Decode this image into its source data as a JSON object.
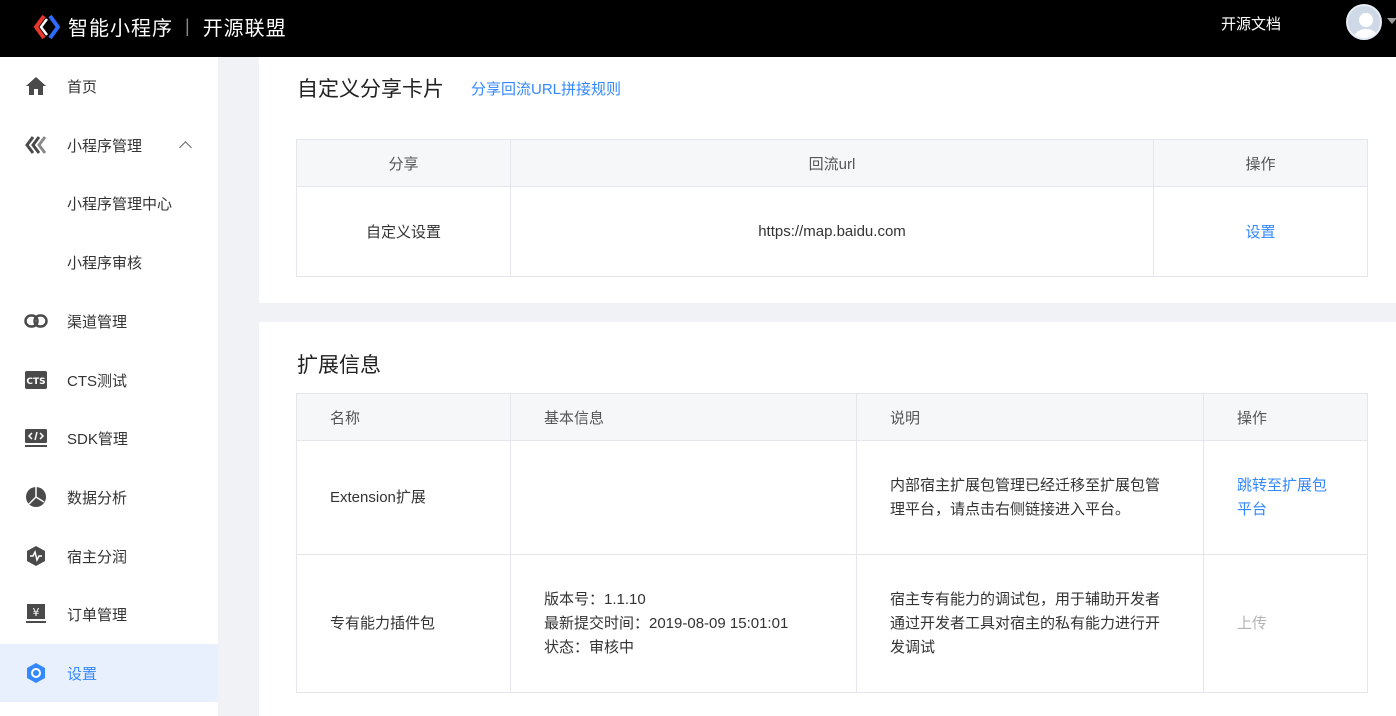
{
  "header": {
    "brand_main": "智能小程序",
    "brand_sub": "开源联盟",
    "doc_link": "开源文档"
  },
  "sidebar": {
    "items": [
      {
        "label": "首页",
        "icon": "home-icon"
      },
      {
        "label": "小程序管理",
        "icon": "miniprogram-icon"
      },
      {
        "label": "小程序管理中心"
      },
      {
        "label": "小程序审核"
      },
      {
        "label": "渠道管理",
        "icon": "link-icon"
      },
      {
        "label": "CTS测试",
        "icon": "cts-icon"
      },
      {
        "label": "SDK管理",
        "icon": "sdk-code-icon"
      },
      {
        "label": "数据分析",
        "icon": "pie-chart-icon"
      },
      {
        "label": "宿主分润",
        "icon": "pulse-icon"
      },
      {
        "label": "订单管理",
        "icon": "yen-monitor-icon"
      },
      {
        "label": "设置",
        "icon": "settings-icon"
      }
    ]
  },
  "share_card": {
    "title": "自定义分享卡片",
    "rule_link": "分享回流URL拼接规则",
    "columns": [
      "分享",
      "回流url",
      "操作"
    ],
    "rows": [
      {
        "share": "自定义设置",
        "url": "https://map.baidu.com",
        "action": "设置"
      }
    ]
  },
  "extension_card": {
    "title": "扩展信息",
    "columns": [
      "名称",
      "基本信息",
      "说明",
      "操作"
    ],
    "rows": [
      {
        "name": "Extension扩展",
        "info_lines": [
          "",
          "",
          ""
        ],
        "desc": "内部宿主扩展包管理已经迁移至扩展包管理平台，请点击右侧链接进入平台。",
        "action": "跳转至扩展包平台"
      },
      {
        "name": "专有能力插件包",
        "info_lines": [
          "版本号：1.1.10",
          "最新提交时间：2019-08-09 15:01:01",
          "状态：审核中"
        ],
        "desc": "宿主专有能力的调试包，用于辅助开发者通过开发者工具对宿主的私有能力进行开发调试",
        "action": "上传"
      }
    ]
  },
  "colors": {
    "accent": "#3388ff",
    "header_bg": "#000000",
    "active_bg": "#e9f0fd"
  }
}
